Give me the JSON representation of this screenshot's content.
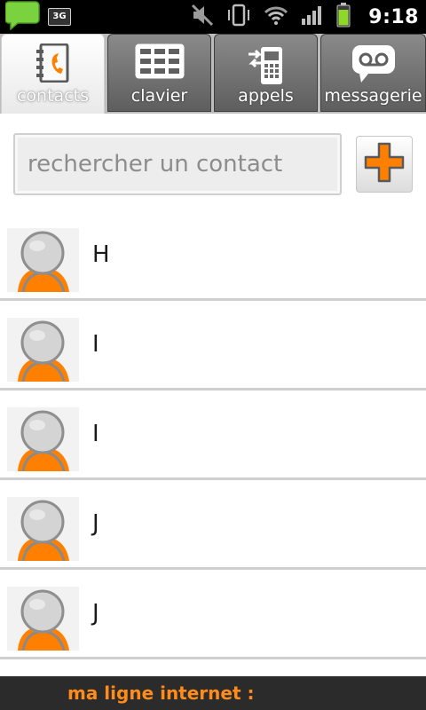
{
  "status_bar": {
    "time": "9:18",
    "network_type": "3G",
    "icons": [
      "chat-notification-icon",
      "mute-icon",
      "vibrate-icon",
      "wifi-icon",
      "signal-icon",
      "battery-icon"
    ]
  },
  "tabs": [
    {
      "label": "contacts",
      "icon": "address-book-icon",
      "active": true
    },
    {
      "label": "clavier",
      "icon": "keypad-icon",
      "active": false
    },
    {
      "label": "appels",
      "icon": "call-log-icon",
      "active": false
    },
    {
      "label": "messagerie",
      "icon": "voicemail-icon",
      "active": false
    }
  ],
  "search": {
    "placeholder": "rechercher un contact",
    "value": ""
  },
  "add_button_icon": "plus-icon",
  "contacts": [
    {
      "name": "H"
    },
    {
      "name": "I"
    },
    {
      "name": "I"
    },
    {
      "name": "J"
    },
    {
      "name": "J"
    }
  ],
  "footer": {
    "label": "ma ligne internet :"
  },
  "colors": {
    "accent": "#ff7f00",
    "tab_inactive": "#6b6b6b",
    "footer_bg": "#2b2b2b",
    "footer_text": "#ff8c1a"
  }
}
